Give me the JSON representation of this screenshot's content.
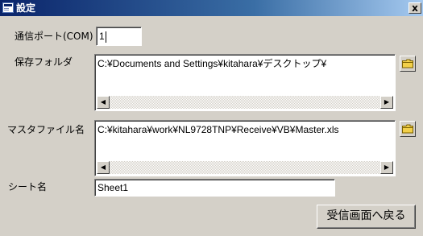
{
  "window": {
    "title": "設定",
    "close_label": "x"
  },
  "form": {
    "com_port": {
      "label": "通信ポート(COM)",
      "value": "1"
    },
    "save_folder": {
      "label": "保存フォルダ",
      "value": "C:¥Documents and Settings¥kitahara¥デスクトップ¥"
    },
    "master_file": {
      "label": "マスタファイル名",
      "value": "C:¥kitahara¥work¥NL9728TNP¥Receive¥VB¥Master.xls"
    },
    "sheet_name": {
      "label": "シート名",
      "value": "Sheet1"
    }
  },
  "buttons": {
    "back_label": "受信画面へ戻る"
  },
  "icons": {
    "browse_save_folder": "folder-icon",
    "browse_master_file": "folder-icon",
    "window_icon": "form-icon"
  }
}
